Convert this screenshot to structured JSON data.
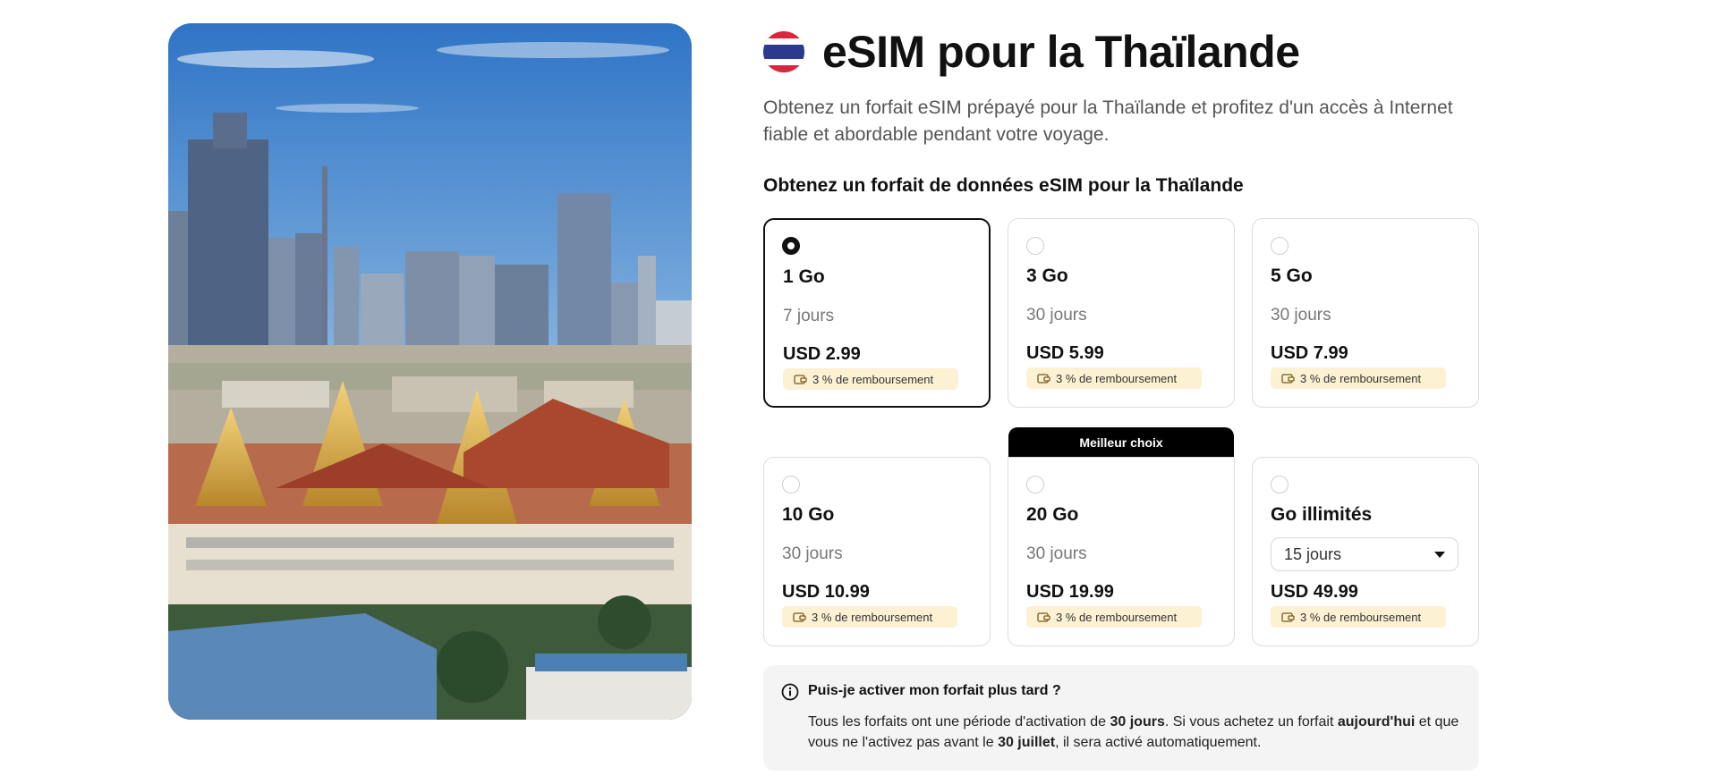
{
  "page": {
    "title": "eSIM pour la Thaïlande",
    "subtitle": "Obtenez un forfait eSIM prépayé pour la Thaïlande et profitez d'un accès à Internet fiable et abordable pendant votre voyage.",
    "section_heading": "Obtenez un forfait de données eSIM pour la Thaïlande",
    "flag_icon": "thailand-flag-icon"
  },
  "colors": {
    "accent": "#111111",
    "cashback_bg": "#fdf1d3",
    "badge_bg": "#000000",
    "muted_text": "#777777",
    "info_bg": "#f4f4f4"
  },
  "plans": [
    {
      "size": "1 Go",
      "duration": "7 jours",
      "price": "USD 2.99",
      "cashback": "3 % de remboursement",
      "selected": true
    },
    {
      "size": "3 Go",
      "duration": "30 jours",
      "price": "USD 5.99",
      "cashback": "3 % de remboursement",
      "selected": false
    },
    {
      "size": "5 Go",
      "duration": "30 jours",
      "price": "USD 7.99",
      "cashback": "3 % de remboursement",
      "selected": false
    },
    {
      "size": "10 Go",
      "duration": "30 jours",
      "price": "USD 10.99",
      "cashback": "3 % de remboursement",
      "selected": false
    },
    {
      "size": "20 Go",
      "duration": "30 jours",
      "price": "USD 19.99",
      "cashback": "3 % de remboursement",
      "selected": false,
      "badge": "Meilleur choix"
    },
    {
      "size": "Go illimités",
      "duration_select": "15 jours",
      "price": "USD 49.99",
      "cashback": "3 % de remboursement",
      "selected": false
    }
  ],
  "info": {
    "title": "Puis-je activer mon forfait plus tard ?",
    "text_1": "Tous les forfaits ont une période d'activation de ",
    "bold_1": "30 jours",
    "text_2": ". Si vous achetez un forfait ",
    "bold_2": "aujourd'hui",
    "text_3": " et que vous ne l'activez pas avant le ",
    "bold_3": "30 juillet",
    "text_4": ", il sera activé automatiquement."
  }
}
